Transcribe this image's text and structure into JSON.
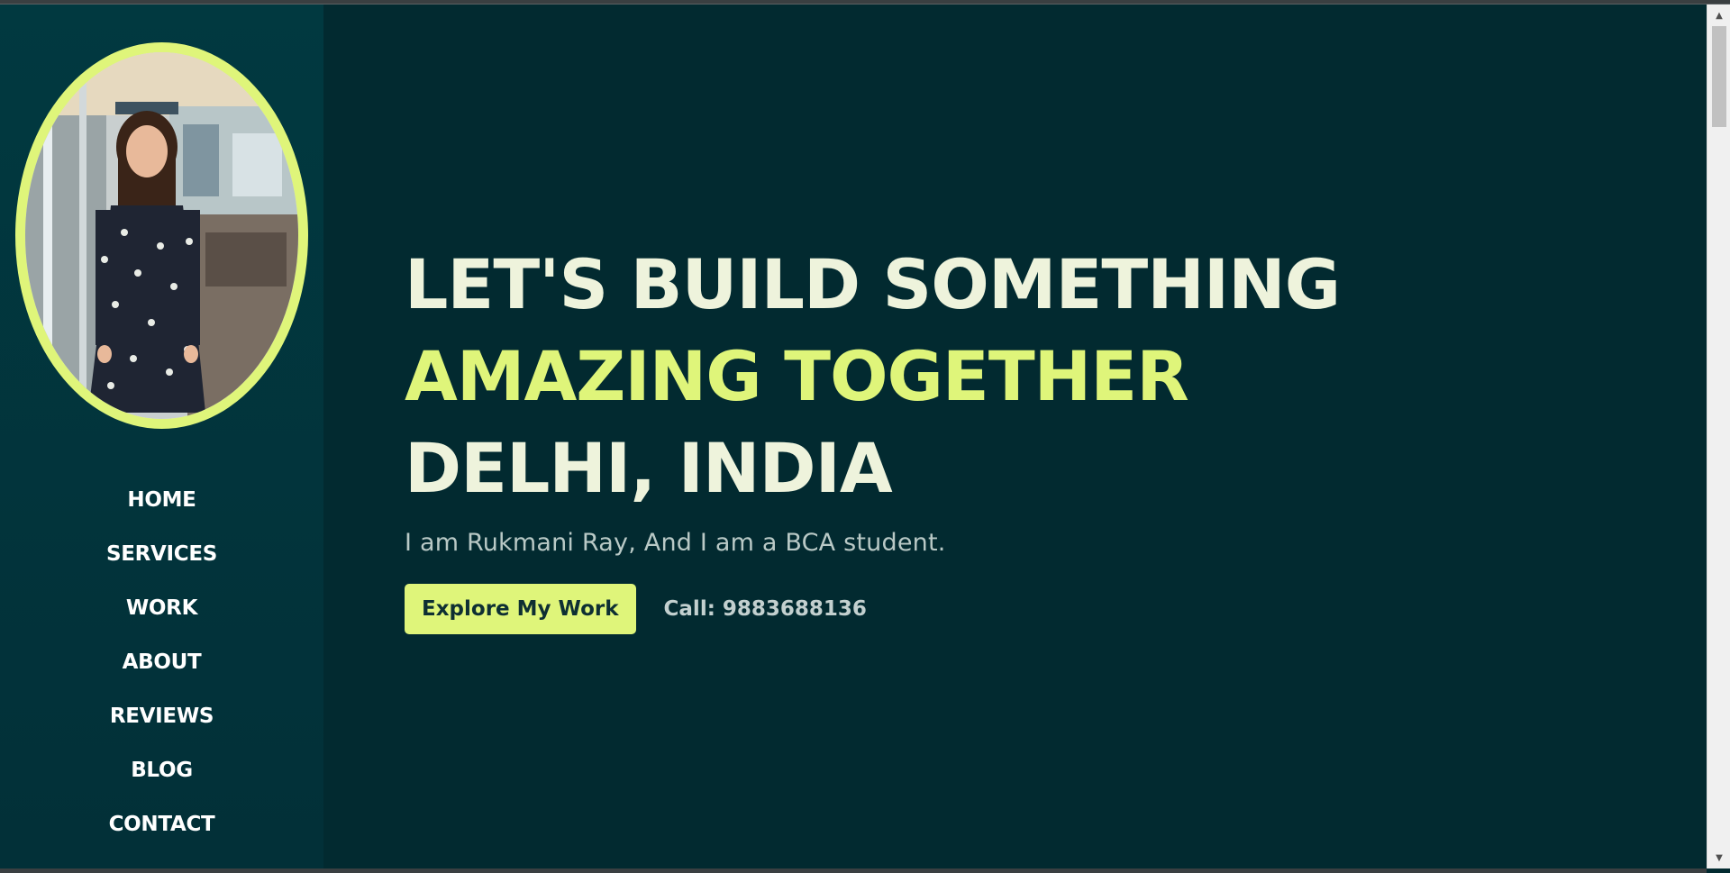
{
  "sidebar": {
    "nav": [
      {
        "label": "HOME"
      },
      {
        "label": "SERVICES"
      },
      {
        "label": "WORK"
      },
      {
        "label": "ABOUT"
      },
      {
        "label": "REVIEWS"
      },
      {
        "label": "BLOG"
      },
      {
        "label": "CONTACT"
      }
    ]
  },
  "hero": {
    "line1": "LET'S BUILD SOMETHING",
    "line2": "AMAZING TOGETHER",
    "line3": "DELHI, INDIA",
    "subtitle": "I am Rukmani Ray, And I am a BCA student.",
    "cta_label": "Explore My Work",
    "call_text": "Call: 9883688136"
  },
  "colors": {
    "background": "#022a30",
    "sidebar": "#013940",
    "accent": "#dff57a",
    "heading": "#eef3dc"
  }
}
